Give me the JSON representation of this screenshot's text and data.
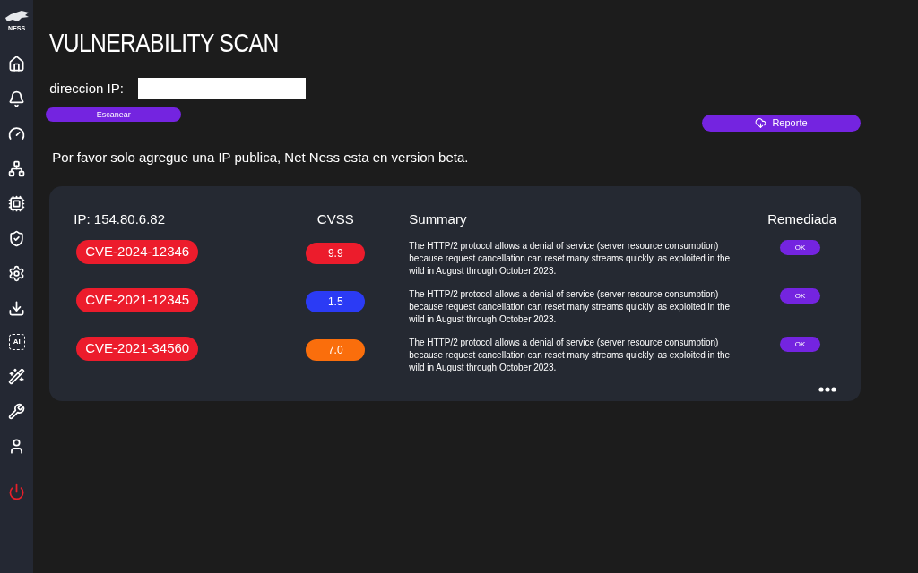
{
  "sidebar": {
    "logo": "NESS",
    "items": [
      {
        "kind": "home"
      },
      {
        "kind": "bell"
      },
      {
        "kind": "gauge"
      },
      {
        "kind": "network"
      },
      {
        "kind": "chip"
      },
      {
        "kind": "shield"
      },
      {
        "kind": "settings"
      },
      {
        "kind": "download"
      },
      {
        "kind": "ai",
        "label": "AI"
      },
      {
        "kind": "wand"
      },
      {
        "kind": "tools"
      },
      {
        "kind": "user"
      },
      {
        "kind": "power"
      }
    ]
  },
  "title": "VULNERABILITY SCAN",
  "ip_field": {
    "label": "direccion IP:"
  },
  "scan_button": "Escanear",
  "report_button": "Reporte",
  "notice": "Por favor solo agregue una IP publica, Net Ness esta en version beta.",
  "results": {
    "columns": [
      "IP: 154.80.6.82",
      "CVSS",
      "Summary",
      "Remediada"
    ],
    "rows": [
      {
        "cve": "CVE-2024-12346",
        "cvss": "9.9",
        "color": "#ec1c2c",
        "summary": "The HTTP/2 protocol allows a denial of service (server resource consumption) because request cancellation can reset many streams quickly, as exploited in the wild in August through October 2023.",
        "remediated": "OK"
      },
      {
        "cve": "CVE-2021-12345",
        "cvss": "1.5",
        "color": "#2b3bf5",
        "summary": "The HTTP/2 protocol allows a denial of service (server resource consumption) because request cancellation can reset many streams quickly, as exploited in the wild in August through October 2023.",
        "remediated": "OK"
      },
      {
        "cve": "CVE-2021-34560",
        "cvss": "7.0",
        "color": "#fa6e0c",
        "summary": "The HTTP/2 protocol allows a denial of service (server resource consumption) because request cancellation can reset many streams quickly, as exploited in the wild in August through October 2023.",
        "remediated": "OK"
      }
    ]
  }
}
